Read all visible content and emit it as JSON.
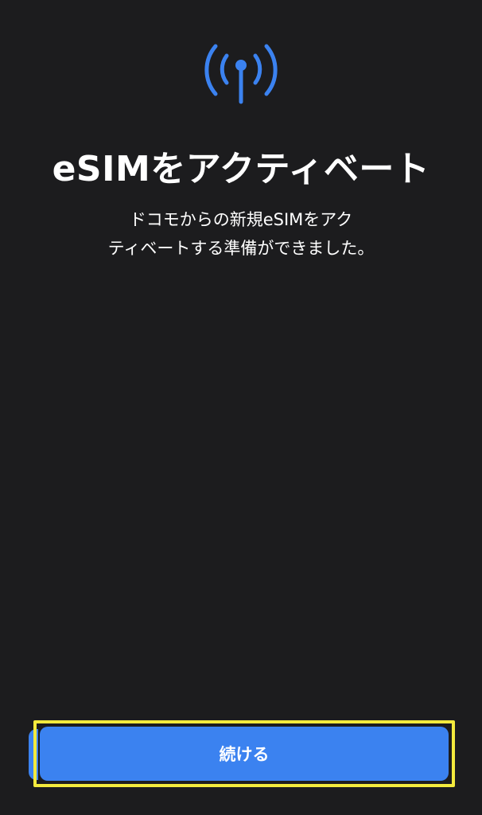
{
  "header": {
    "icon": "antenna-signal-icon",
    "title": "eSIMをアクティベート"
  },
  "body": {
    "description_line1": "ドコモからの新規eSIMをアク",
    "description_line2": "ティベートする準備ができました。"
  },
  "footer": {
    "continue_label": "続ける"
  },
  "colors": {
    "background": "#1c1c1e",
    "accent": "#3b82f0",
    "highlight": "#f3ea3d"
  }
}
